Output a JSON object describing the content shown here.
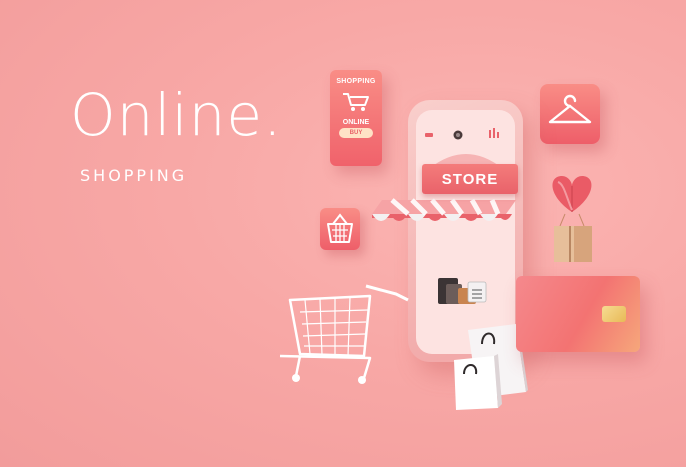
{
  "headline": {
    "title": "Online.",
    "subtitle": "SHOPPING"
  },
  "store_sign": "STORE",
  "shop_badge": {
    "top_label": "SHOPPING",
    "middle_label": "ONLINE",
    "button_label": "BUY"
  },
  "colors": {
    "background": "#f8a8a6",
    "accent": "#ee5e69",
    "light_pink": "#fde3e1",
    "gold": "#e8b956"
  },
  "icons": [
    "hanger-icon",
    "basket-icon",
    "cart-icon",
    "heart-balloon-icon",
    "parcel-box-icon",
    "shopping-bag-icon",
    "credit-card-icon"
  ]
}
